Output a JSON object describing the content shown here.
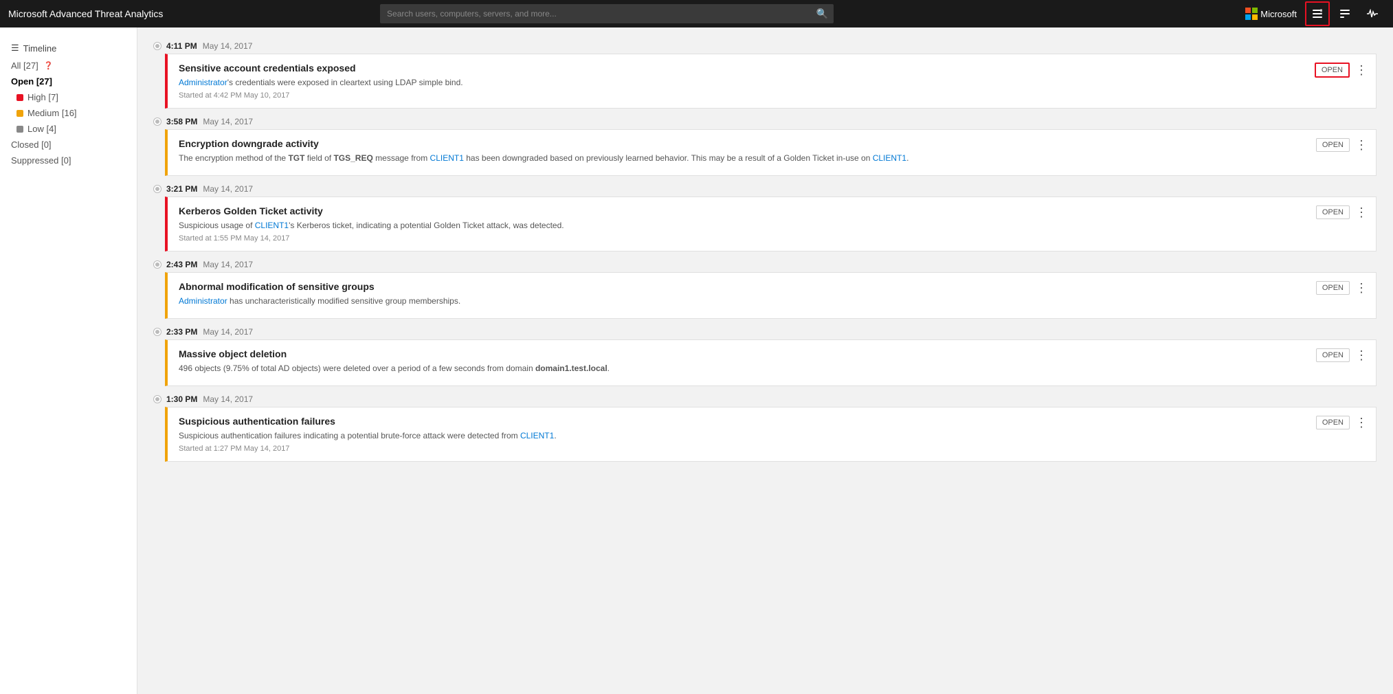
{
  "header": {
    "title": "Microsoft Advanced Threat Analytics",
    "search_placeholder": "Search users, computers, servers, and more...",
    "ms_label": "Microsoft"
  },
  "sidebar": {
    "section_title": "Timeline",
    "items": [
      {
        "id": "all",
        "label": "All [27]",
        "active": false,
        "sub": false,
        "dot": null
      },
      {
        "id": "open",
        "label": "Open [27]",
        "active": true,
        "sub": false,
        "dot": null
      },
      {
        "id": "high",
        "label": "High [7]",
        "active": false,
        "sub": true,
        "dot": "red"
      },
      {
        "id": "medium",
        "label": "Medium [16]",
        "active": false,
        "sub": true,
        "dot": "yellow"
      },
      {
        "id": "low",
        "label": "Low [4]",
        "active": false,
        "sub": true,
        "dot": "gray"
      },
      {
        "id": "closed",
        "label": "Closed [0]",
        "active": false,
        "sub": false,
        "dot": null
      },
      {
        "id": "suppressed",
        "label": "Suppressed [0]",
        "active": false,
        "sub": false,
        "dot": null
      }
    ]
  },
  "timeline": {
    "groups": [
      {
        "id": "g1",
        "time_bold": "4:11 PM",
        "time_light": "May 14, 2017",
        "card": {
          "title": "Sensitive account credentials exposed",
          "severity": "red",
          "description_parts": [
            {
              "text": "",
              "type": "plain"
            },
            {
              "text": "Administrator",
              "type": "link"
            },
            {
              "text": "'s credentials were exposed in cleartext using LDAP simple bind.",
              "type": "plain"
            }
          ],
          "description_plain": "'s credentials were exposed in cleartext using LDAP simple bind.",
          "started": "Started at 4:42 PM May 10, 2017",
          "open_highlighted": true
        }
      },
      {
        "id": "g2",
        "time_bold": "3:58 PM",
        "time_light": "May 14, 2017",
        "card": {
          "title": "Encryption downgrade activity",
          "severity": "yellow",
          "description": "The encryption method of the TGT field of TGS_REQ message from CLIENT1 has been downgraded based on previously learned behavior. This may be a result of a Golden Ticket in-use on CLIENT1.",
          "description_parts": [
            {
              "text": "The encryption method of the ",
              "type": "plain"
            },
            {
              "text": "TGT",
              "type": "bold"
            },
            {
              "text": " field of ",
              "type": "plain"
            },
            {
              "text": "TGS_REQ",
              "type": "bold"
            },
            {
              "text": " message from ",
              "type": "plain"
            },
            {
              "text": "CLIENT1",
              "type": "link"
            },
            {
              "text": " has been downgraded based on previously learned behavior. This may be a result of a Golden Ticket in-use on ",
              "type": "plain"
            },
            {
              "text": "CLIENT1",
              "type": "link"
            },
            {
              "text": ".",
              "type": "plain"
            }
          ],
          "started": null,
          "open_highlighted": false
        }
      },
      {
        "id": "g3",
        "time_bold": "3:21 PM",
        "time_light": "May 14, 2017",
        "card": {
          "title": "Kerberos Golden Ticket activity",
          "severity": "red",
          "description_parts": [
            {
              "text": "Suspicious usage of ",
              "type": "plain"
            },
            {
              "text": "CLIENT1",
              "type": "link"
            },
            {
              "text": "'s Kerberos ticket, indicating a potential Golden Ticket attack, was detected.",
              "type": "plain"
            }
          ],
          "started": "Started at 1:55 PM May 14, 2017",
          "open_highlighted": false
        }
      },
      {
        "id": "g4",
        "time_bold": "2:43 PM",
        "time_light": "May 14, 2017",
        "card": {
          "title": "Abnormal modification of sensitive groups",
          "severity": "yellow",
          "description_parts": [
            {
              "text": "Administrator",
              "type": "link"
            },
            {
              "text": " has uncharacteristically modified sensitive group memberships.",
              "type": "plain"
            }
          ],
          "started": null,
          "open_highlighted": false
        }
      },
      {
        "id": "g5",
        "time_bold": "2:33 PM",
        "time_light": "May 14, 2017",
        "card": {
          "title": "Massive object deletion",
          "severity": "yellow",
          "description_parts": [
            {
              "text": "496 objects (9.75% of total AD objects) were deleted over a period of a few seconds from domain ",
              "type": "plain"
            },
            {
              "text": "domain1.test.local",
              "type": "bold"
            },
            {
              "text": ".",
              "type": "plain"
            }
          ],
          "started": null,
          "open_highlighted": false
        }
      },
      {
        "id": "g6",
        "time_bold": "1:30 PM",
        "time_light": "May 14, 2017",
        "card": {
          "title": "Suspicious authentication failures",
          "severity": "yellow",
          "description_parts": [
            {
              "text": "Suspicious authentication failures indicating a potential brute-force attack were detected from ",
              "type": "plain"
            },
            {
              "text": "CLIENT1",
              "type": "link"
            },
            {
              "text": ".",
              "type": "plain"
            }
          ],
          "started": "Started at 1:27 PM May 14, 2017",
          "open_highlighted": false
        }
      }
    ]
  },
  "labels": {
    "open_btn": "OPEN",
    "more_btn": "⋮",
    "timeline_icon": "≡",
    "help_icon": "?",
    "list_icon": "☰"
  }
}
